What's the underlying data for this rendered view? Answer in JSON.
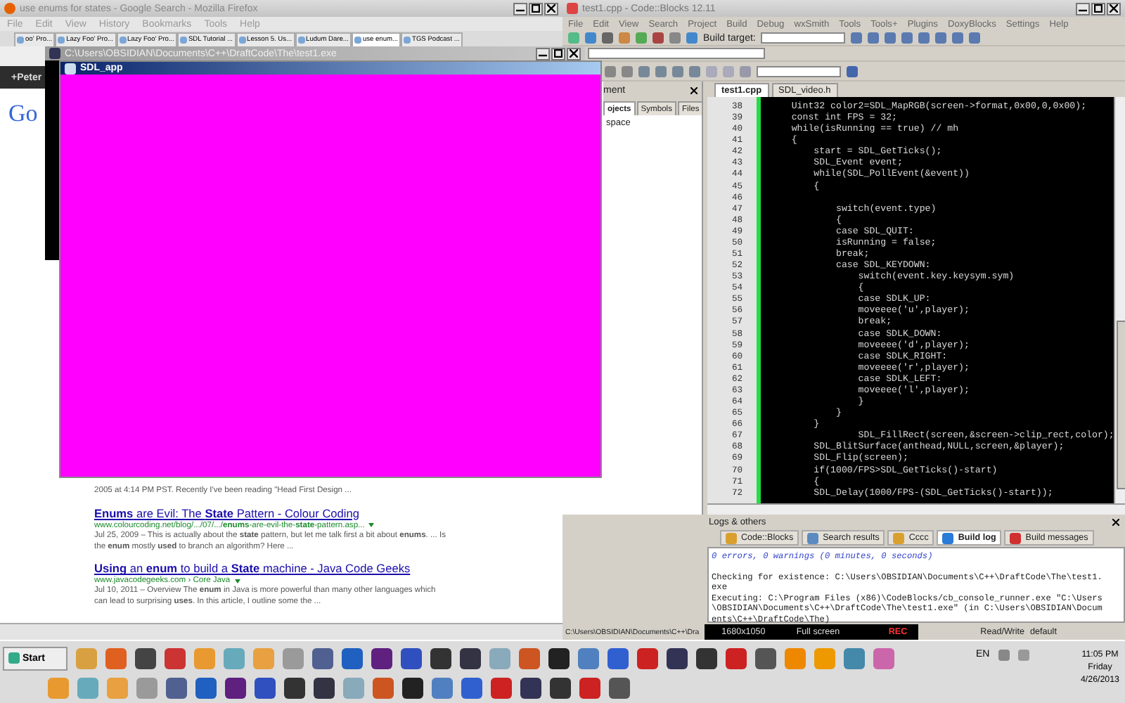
{
  "firefox": {
    "title": "use enums for states - Google Search - Mozilla Firefox",
    "menu": [
      "File",
      "Edit",
      "View",
      "History",
      "Bookmarks",
      "Tools",
      "Help"
    ],
    "tabs": [
      {
        "label": "oo' Pro...",
        "selected": false
      },
      {
        "label": "Lazy Foo' Pro...",
        "selected": false
      },
      {
        "label": "Lazy Foo' Pro...",
        "selected": false
      },
      {
        "label": "SDL Tutorial ...",
        "selected": false
      },
      {
        "label": "Lesson 5. Us...",
        "selected": false
      },
      {
        "label": "Ludum Dare...",
        "selected": false
      },
      {
        "label": "use enum...",
        "selected": true
      },
      {
        "label": "TGS Podcast ...",
        "selected": false
      }
    ],
    "account": "+Peter",
    "logo": "Go",
    "results": [
      {
        "snippet": "2005 at 4:14 PM PST. Recently I've been reading \"Head First Design ..."
      },
      {
        "title": "**Enums** are Evil: The **State** Pattern - Colour Coding",
        "url": "www.colourcoding.net/blog/.../07/.../**enums**-are-evil-the-**state**-pattern.asp...",
        "snippet": "Jul 25, 2009 – This is actually about the **state** pattern, but let me talk first a bit about **enums**. ... Is the **enum** mostly **used** to branch an algorithm? Here ..."
      },
      {
        "title": "**Using** an **enum** to build a **State** machine - Java Code Geeks",
        "url": "www.javacodegeeks.com › Core Java",
        "snippet": "Jul 10, 2011 – Overview The **enum** in Java is more powerful than many other languages which can lead to surprising **uses**. In this article, I outline some the ..."
      }
    ]
  },
  "console_window": {
    "title": "C:\\Users\\OBSIDIAN\\Documents\\C++\\DraftCode\\The\\test1.exe"
  },
  "sdl_window": {
    "title": "SDL_app"
  },
  "codeblocks": {
    "title": "test1.cpp - Code::Blocks 12.11",
    "menu": [
      "File",
      "Edit",
      "View",
      "Search",
      "Project",
      "Build",
      "Debug",
      "wxSmith",
      "Tools",
      "Tools+",
      "Plugins",
      "DoxyBlocks",
      "Settings",
      "Help"
    ],
    "build_target_label": "Build target:",
    "management": {
      "title": "ment",
      "tabs": [
        {
          "label": "ojects",
          "selected": true
        },
        {
          "label": "Symbols",
          "selected": false
        },
        {
          "label": "Files",
          "selected": false
        }
      ],
      "tree_item": "space"
    },
    "editor_tabs": [
      {
        "label": "test1.cpp",
        "selected": true
      },
      {
        "label": "SDL_video.h",
        "selected": false
      }
    ],
    "lines": [
      {
        "n": "38",
        "code": "    Uint32 color2=SDL_MapRGB(screen->format,0x00,0,0x00);"
      },
      {
        "n": "39",
        "code": "    const int FPS = 32;"
      },
      {
        "n": "40",
        "code": "    while(isRunning == true) // mh"
      },
      {
        "n": "41",
        "code": "    {"
      },
      {
        "n": "42",
        "code": "        start = SDL_GetTicks();"
      },
      {
        "n": "43",
        "code": "        SDL_Event event;"
      },
      {
        "n": "44",
        "code": "        while(SDL_PollEvent(&event))"
      },
      {
        "n": "45",
        "code": "        {"
      },
      {
        "n": "46"
      },
      {
        "n": "47",
        "code": "            switch(event.type)"
      },
      {
        "n": "48",
        "code": "            {"
      },
      {
        "n": "49",
        "code": "            case SDL_QUIT:"
      },
      {
        "n": "50",
        "code": "            isRunning = false;"
      },
      {
        "n": "51",
        "code": "            break;"
      },
      {
        "n": "52",
        "code": "            case SDL_KEYDOWN:"
      },
      {
        "n": "53",
        "code": "                switch(event.key.keysym.sym)"
      },
      {
        "n": "54",
        "code": "                {"
      },
      {
        "n": "55",
        "code": "                case SDLK_UP:"
      },
      {
        "n": "56",
        "code": "                moveeee('u',player);"
      },
      {
        "n": "57",
        "code": "                break;"
      },
      {
        "n": "58",
        "code": "                case SDLK_DOWN:"
      },
      {
        "n": "59",
        "code": "                moveeee('d',player);"
      },
      {
        "n": "60",
        "code": "                case SDLK_RIGHT:"
      },
      {
        "n": "61",
        "code": "                moveeee('r',player);"
      },
      {
        "n": "62",
        "code": "                case SDLK_LEFT:"
      },
      {
        "n": "63",
        "code": "                moveeee('l',player);"
      },
      {
        "n": "64",
        "code": "                }"
      },
      {
        "n": "65",
        "code": "            }"
      },
      {
        "n": "66",
        "code": "        }"
      },
      {
        "n": "67",
        "code": "                SDL_FillRect(screen,&screen->clip_rect,color);"
      },
      {
        "n": "68",
        "code": "        SDL_BlitSurface(anthead,NULL,screen,&player);"
      },
      {
        "n": "69",
        "code": "        SDL_Flip(screen);"
      },
      {
        "n": "70",
        "code": "        if(1000/FPS>SDL_GetTicks()-start)"
      },
      {
        "n": "71",
        "code": "        {"
      },
      {
        "n": "72",
        "code": "        SDL_Delay(1000/FPS-(SDL_GetTicks()-start));"
      }
    ],
    "logs_title": "Logs & others",
    "log_tabs": [
      {
        "label": "Code::Blocks",
        "selected": false
      },
      {
        "label": "Search results",
        "selected": false
      },
      {
        "label": "Cccc",
        "selected": false
      },
      {
        "label": "Build log",
        "selected": true
      },
      {
        "label": "Build messages",
        "selected": false
      }
    ],
    "log_lines": [
      {
        "kind": "status",
        "text": "0 errors, 0 warnings (0 minutes, 0 seconds)"
      },
      {
        "kind": "plain",
        "text": "Checking for existence: C:\\Users\\OBSIDIAN\\Documents\\C++\\DraftCode\\The\\test1.exe"
      },
      {
        "kind": "plain",
        "text": "Executing: C:\\Program Files (x86)\\CodeBlocks/cb_console_runner.exe \"C:\\Users\\OBSIDIAN\\Documents\\C++\\DraftCode\\The\\test1.exe\" (in C:\\Users\\OBSIDIAN\\Documents\\C++\\DraftCode\\The)"
      }
    ],
    "status_path": "C:\\Users\\OBSIDIAN\\Documents\\C++\\Dra",
    "recorder": {
      "resolution": "1680x1050",
      "mode": "Full screen",
      "rec": "REC"
    },
    "status_mode": "Read/Write",
    "status_profile": "default"
  },
  "taskbar": {
    "start": "Start",
    "language": "EN",
    "time": "11:05 PM",
    "day": "Friday",
    "date": "4/26/2013"
  }
}
